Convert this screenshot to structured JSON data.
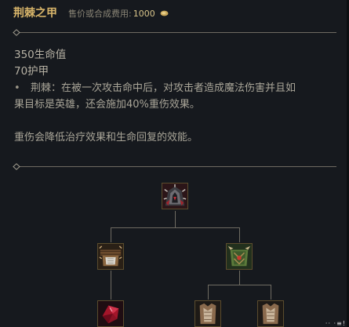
{
  "item": {
    "name": "荆棘之甲",
    "price_label": "售价或合成费用:",
    "price": "1000"
  },
  "stats": [
    "350生命值",
    "70护甲"
  ],
  "passive": {
    "line1": "荆棘：在被一次攻击命中后，对攻击者造成魔法伤害并且如",
    "line2": "果目标是英雄，还会施加40%重伤效果。"
  },
  "note": "重伤会降低治疗效果和生命回复的效能。",
  "recipe_tree": {
    "root": {
      "icon": "thornmail-icon"
    },
    "children": [
      {
        "icon": "bramble-vest-icon",
        "children": [
          {
            "icon": "ruby-crystal-icon"
          }
        ]
      },
      {
        "icon": "warden-mail-icon",
        "children": [
          {
            "icon": "cloth-armor-icon"
          },
          {
            "icon": "cloth-armor-icon"
          }
        ]
      }
    ]
  },
  "watermark": "·· ·≡!",
  "colors": {
    "title": "#d8b56a",
    "price": "#d8c48a",
    "frame": "#5b4c2d",
    "background": "#16191e"
  }
}
